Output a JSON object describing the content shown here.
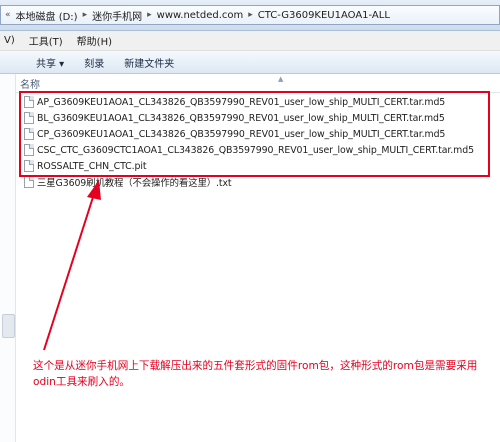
{
  "address": {
    "crumbs": [
      "本地磁盘 (D:)",
      "迷你手机网",
      "www.netded.com",
      "CTC-G3609KEU1AOA1-ALL"
    ]
  },
  "menubar": {
    "items": [
      "V)",
      "工具(T)",
      "帮助(H)"
    ]
  },
  "toolbar": {
    "items": [
      "共享 ▾",
      "刻录",
      "新建文件夹"
    ]
  },
  "columns": {
    "name": "名称"
  },
  "files": [
    "AP_G3609KEU1AOA1_CL343826_QB3597990_REV01_user_low_ship_MULTI_CERT.tar.md5",
    "BL_G3609KEU1AOA1_CL343826_QB3597990_REV01_user_low_ship_MULTI_CERT.tar.md5",
    "CP_G3609KEU1AOA1_CL343826_QB3597990_REV01_user_low_ship_MULTI_CERT.tar.md5",
    "CSC_CTC_G3609CTC1AOA1_CL343826_QB3597990_REV01_user_low_ship_MULTI_CERT.tar.md5",
    "ROSSALTE_CHN_CTC.pit",
    "三星G3609刷机教程（不会操作的看这里）.txt"
  ],
  "annotation": {
    "text": "这个是从迷你手机网上下载解压出来的五件套形式的固件rom包，这种形式的rom包是需要采用odin工具来刷入的。"
  },
  "colors": {
    "highlight": "#e6001f"
  }
}
